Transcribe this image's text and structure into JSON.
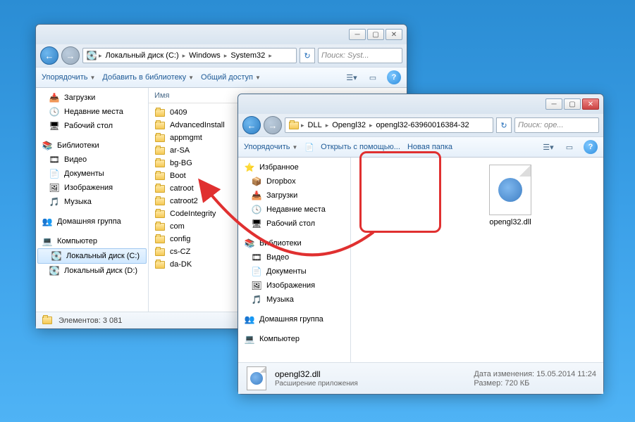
{
  "window1": {
    "breadcrumbs": [
      "Локальный диск (C:)",
      "Windows",
      "System32"
    ],
    "search_placeholder": "Поиск: Syst...",
    "toolbar": {
      "organize": "Упорядочить",
      "add_library": "Добавить в библиотеку",
      "share": "Общий доступ"
    },
    "sidebar": {
      "downloads": "Загрузки",
      "recent": "Недавние места",
      "desktop": "Рабочий стол",
      "libraries": "Библиотеки",
      "videos": "Видео",
      "documents": "Документы",
      "pictures": "Изображения",
      "music": "Музыка",
      "homegroup": "Домашняя группа",
      "computer": "Компьютер",
      "drive_c": "Локальный диск (C:)",
      "drive_d": "Локальный диск (D:)"
    },
    "col_name": "Имя",
    "folders": [
      "0409",
      "AdvancedInstall",
      "appmgmt",
      "ar-SA",
      "bg-BG",
      "Boot",
      "catroot",
      "catroot2",
      "CodeIntegrity",
      "com",
      "config",
      "cs-CZ",
      "da-DK"
    ],
    "status": "Элементов: 3 081"
  },
  "window2": {
    "breadcrumbs": [
      "DLL",
      "Opengl32",
      "opengl32-63960016384-32"
    ],
    "search_placeholder": "Поиск: ope...",
    "toolbar": {
      "organize": "Упорядочить",
      "open_with": "Открыть с помощью...",
      "new_folder": "Новая папка"
    },
    "sidebar": {
      "favorites": "Избранное",
      "dropbox": "Dropbox",
      "downloads": "Загрузки",
      "recent": "Недавние места",
      "desktop": "Рабочий стол",
      "libraries": "Библиотеки",
      "videos": "Видео",
      "documents": "Документы",
      "pictures": "Изображения",
      "music": "Музыка",
      "homegroup": "Домашняя группа",
      "computer": "Компьютер"
    },
    "file": {
      "name": "opengl32.dll",
      "type": "Расширение приложения",
      "date_label": "Дата изменения:",
      "date": "15.05.2014 11:24",
      "size_label": "Размер:",
      "size": "720 КБ"
    },
    "open_icon_label": "📄"
  }
}
